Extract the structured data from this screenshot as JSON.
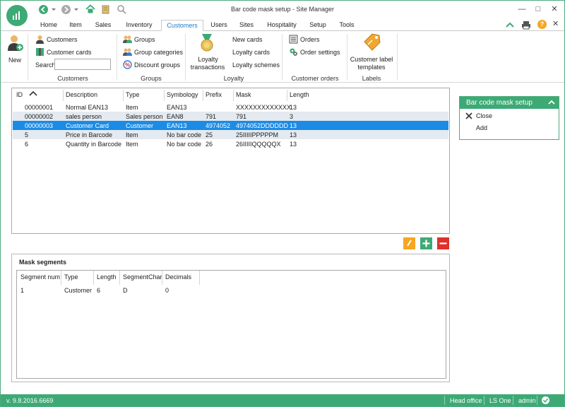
{
  "window": {
    "title": "Bar code mask setup - Site Manager"
  },
  "tabs": [
    "Home",
    "Item",
    "Sales",
    "Inventory",
    "Customers",
    "Users",
    "Sites",
    "Hospitality",
    "Setup",
    "Tools"
  ],
  "ribbon": {
    "new_label": "New",
    "customers_group": {
      "label": "Customers",
      "customers": "Customers",
      "customer_cards": "Customer cards",
      "search_label": "Search",
      "search_value": ""
    },
    "groups_group": {
      "label": "Groups",
      "groups": "Groups",
      "group_categories": "Group categories",
      "discount_groups": "Discount groups"
    },
    "loyalty_group": {
      "label": "Loyalty",
      "loyalty_transactions_line1": "Loyalty",
      "loyalty_transactions_line2": "transactions",
      "new_cards": "New cards",
      "loyalty_cards": "Loyalty cards",
      "loyalty_schemes": "Loyalty schemes"
    },
    "orders_group": {
      "label": "Customer orders",
      "orders": "Orders",
      "order_settings": "Order settings"
    },
    "labels_group": {
      "label": "Labels",
      "templates_line1": "Customer label",
      "templates_line2": "templates"
    }
  },
  "grid": {
    "columns": [
      "ID",
      "Description",
      "Type",
      "Symbology",
      "Prefix",
      "Mask",
      "Length"
    ],
    "rows": [
      {
        "id": "00000001",
        "description": "Normal EAN13",
        "type": "Item",
        "symbology": "EAN13",
        "prefix": "",
        "mask": "XXXXXXXXXXXXX",
        "length": "13"
      },
      {
        "id": "00000002",
        "description": "sales person",
        "type": "Sales person",
        "symbology": "EAN8",
        "prefix": "791",
        "mask": "791",
        "length": "3"
      },
      {
        "id": "00000003",
        "description": "Customer Card",
        "type": "Customer",
        "symbology": "EAN13",
        "prefix": "4974052",
        "mask": "4974052DDDDDD",
        "length": "13"
      },
      {
        "id": "5",
        "description": "Price in Barcode",
        "type": "Item",
        "symbology": "No bar code",
        "prefix": "25",
        "mask": "25IIIIIPPPPPM",
        "length": "13"
      },
      {
        "id": "6",
        "description": "Quantity in Barcode",
        "type": "Item",
        "symbology": "No bar code",
        "prefix": "26",
        "mask": "26IIIIIQQQQQX",
        "length": "13"
      }
    ],
    "selected_index": 2
  },
  "mask_segments": {
    "title": "Mask segments",
    "columns": [
      "Segment num",
      "Type",
      "Length",
      "SegmentChar",
      "Decimals"
    ],
    "rows": [
      {
        "segment_num": "1",
        "type": "Customer",
        "length": "6",
        "segment_char": "D",
        "decimals": "0"
      }
    ]
  },
  "side_panel": {
    "title": "Bar code mask setup",
    "close": "Close",
    "add": "Add"
  },
  "status_bar": {
    "version": "v. 9.8.2016.6669",
    "store": "Head office",
    "product": "LS One",
    "user": "admin"
  },
  "colors": {
    "brand": "#3daa75",
    "selection": "#1b8be6",
    "edit": "#f5a623",
    "add": "#3daa75",
    "delete": "#e0312a"
  }
}
